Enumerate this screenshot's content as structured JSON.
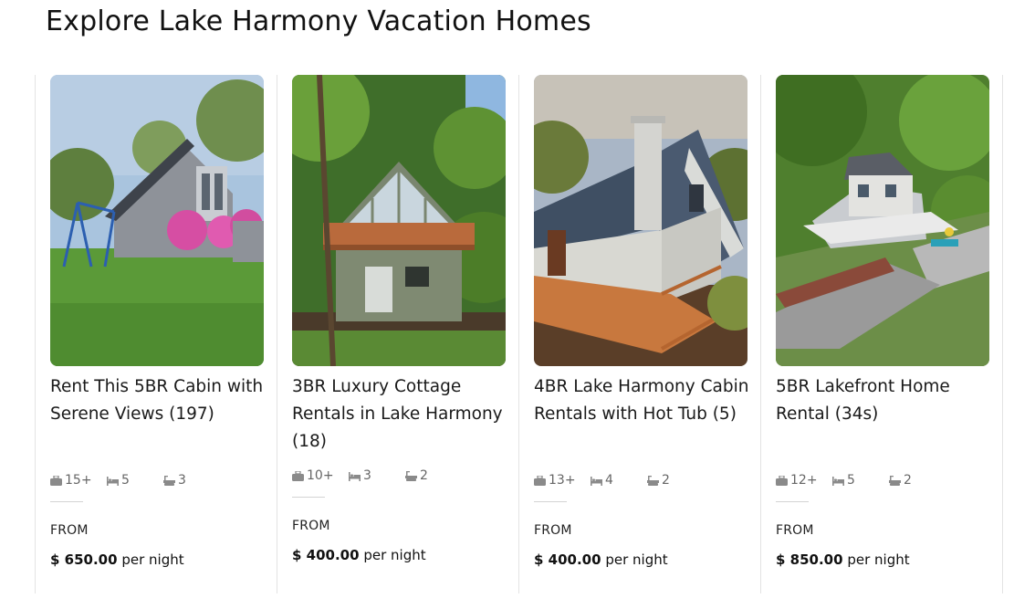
{
  "page": {
    "title": "Explore Lake Harmony Vacation Homes"
  },
  "listings": [
    {
      "title": "Rent This 5BR Cabin with Serene Views (197)",
      "guests": "15+",
      "beds": "5",
      "baths": "3",
      "from_label": "FROM",
      "price": "$ 650.00",
      "per_night": "per night",
      "photo": "cabin-with-swing-set-and-pink-azaleas"
    },
    {
      "title": "3BR Luxury Cottage Rentals in Lake Harmony (18)",
      "guests": "10+",
      "beds": "3",
      "baths": "2",
      "from_label": "FROM",
      "price": "$ 400.00",
      "per_night": "per night",
      "photo": "cottage-with-a-frame-glass-front-and-deck"
    },
    {
      "title": "4BR Lake Harmony Cabin Rentals with Hot Tub (5)",
      "guests": "13+",
      "beds": "4",
      "baths": "2",
      "from_label": "FROM",
      "price": "$ 400.00",
      "per_night": "per night",
      "photo": "a-frame-cabin-with-wraparound-deck"
    },
    {
      "title": "5BR Lakefront Home Rental (34s)",
      "guests": "12+",
      "beds": "5",
      "baths": "2",
      "from_label": "FROM",
      "price": "$ 850.00",
      "per_night": "per night",
      "photo": "lakefront-home-with-dock-aerial"
    }
  ],
  "colors": {
    "lawn": "#5d9a3a",
    "sky": "#9bc3e6",
    "wood": "#c8753e",
    "roof": "#4a5566",
    "water": "#6f8f4a"
  },
  "icons": {
    "guests": "briefcase-icon",
    "beds": "bed-icon",
    "baths": "bathtub-icon"
  }
}
